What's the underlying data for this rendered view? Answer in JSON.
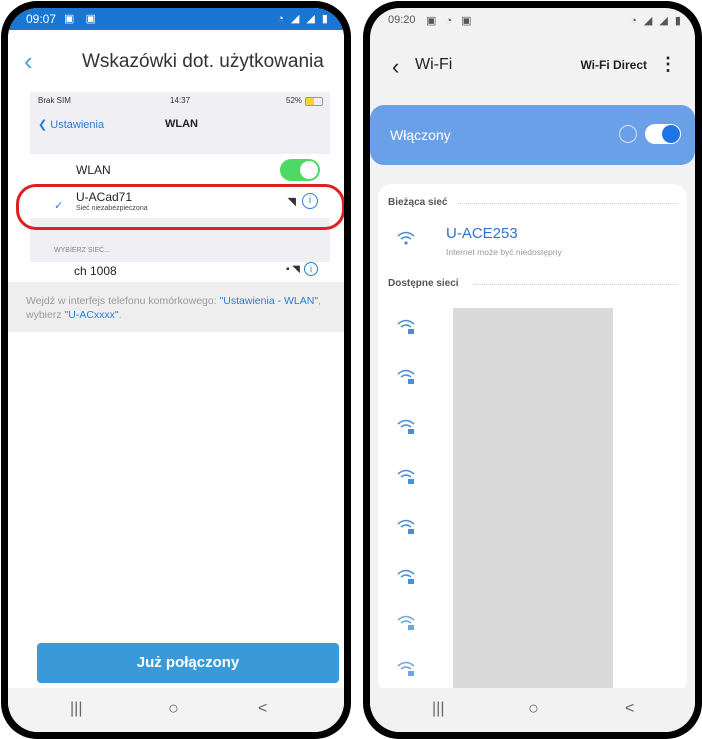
{
  "left_phone": {
    "status_time": "09:07",
    "header_title": "Wskazówki dot. użytkowania",
    "ios": {
      "carrier": "Brak SIM",
      "time": "14:37",
      "battery": "52%",
      "back_label": "Ustawienia",
      "nav_title": "WLAN",
      "wlan_label": "WLAN",
      "network_name": "U-ACad71",
      "network_sub": "Sieć niezabezpieczona",
      "choose_label": "WYBIERZ SIEĆ...",
      "other_network": "ch 1008"
    },
    "hint_prefix": "Wejdź w interfejs telefonu komórkowego: ",
    "hint_link1": "\"Ustawienia - WLAN\"",
    "hint_mid": ", wybierz ",
    "hint_link2": "\"U-ACxxxx\"",
    "hint_suffix": ".",
    "connected_button": "Już połączony"
  },
  "right_phone": {
    "status_time": "09:20",
    "title": "Wi-Fi",
    "wifi_direct": "Wi-Fi Direct",
    "enabled_label": "Włączony",
    "current_section": "Bieżąca sieć",
    "current_network": "U-ACE253",
    "current_sub": "Internet może być niedostępny",
    "available_section": "Dostępne sieci"
  },
  "navbar": {
    "recent": "|||",
    "home": "○",
    "back": "<"
  },
  "colors": {
    "accent_blue": "#1976d2",
    "button_blue": "#3a9ad9",
    "wifi_on_bar": "#6aa0e8",
    "ring_red": "#e02020"
  }
}
